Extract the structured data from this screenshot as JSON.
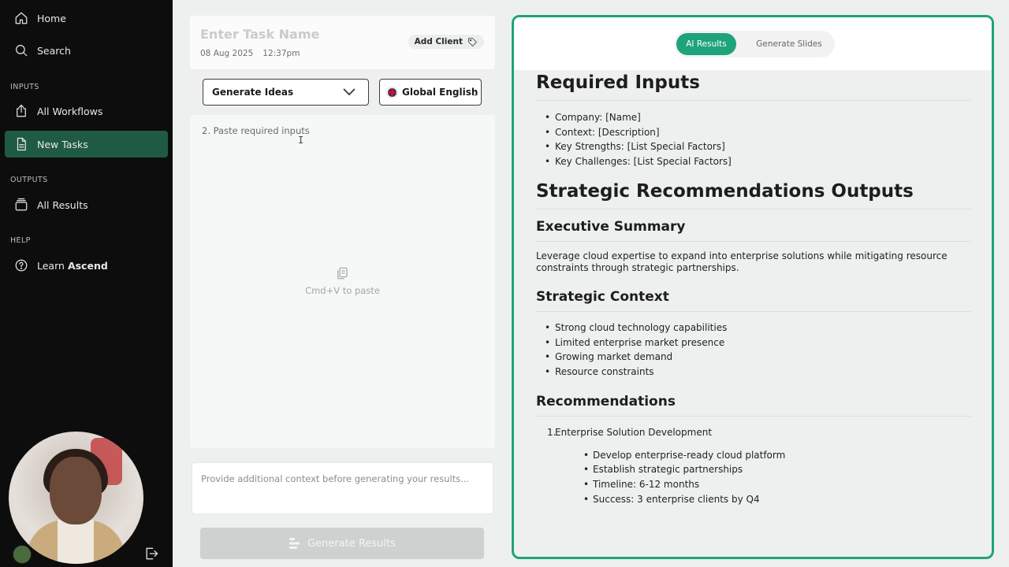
{
  "sidebar": {
    "nav": {
      "home": "Home",
      "search": "Search"
    },
    "sections": {
      "inputs": "INPUTS",
      "outputs": "OUTPUTS",
      "help": "HELP"
    },
    "items": {
      "all_workflows": "All Workflows",
      "new_tasks": "New Tasks",
      "all_results": "All Results",
      "learn_prefix": "Learn",
      "learn_bold": "Ascend"
    },
    "active_item": "New Tasks"
  },
  "task": {
    "name_placeholder": "Enter Task Name",
    "date": "08 Aug 2025",
    "time": "12:37pm",
    "add_client": "Add Client",
    "workflow_select": "Generate Ideas",
    "language_select": "Global English",
    "paste_label": "2. Paste required inputs",
    "paste_hint": "Cmd+V to paste",
    "context_placeholder": "Provide additional context before generating your results...",
    "generate_button": "Generate Results"
  },
  "results": {
    "tabs": [
      "AI Results",
      "Generate Slides"
    ],
    "active_tab": "AI Results",
    "accent_color": "#1fa37a",
    "required_inputs": {
      "heading": "Required Inputs",
      "items": [
        "Company: [Name]",
        "Context: [Description]",
        "Key Strengths: [List Special Factors]",
        "Key Challenges: [List Special Factors]"
      ]
    },
    "outputs_heading": "Strategic Recommendations Outputs",
    "executive_summary": {
      "heading": "Executive Summary",
      "text": "Leverage cloud expertise to expand into enterprise solutions while mitigating resource constraints through strategic partnerships."
    },
    "strategic_context": {
      "heading": "Strategic Context",
      "items": [
        "Strong cloud technology capabilities",
        "Limited enterprise market presence",
        "Growing market demand",
        "Resource constraints"
      ]
    },
    "recommendations": {
      "heading": "Recommendations",
      "first": {
        "number": "1.",
        "title": "Enterprise Solution Development",
        "items": [
          "Develop enterprise-ready cloud platform",
          "Establish strategic partnerships",
          "Timeline: 6-12 months",
          "Success: 3 enterprise clients by Q4"
        ]
      }
    }
  }
}
